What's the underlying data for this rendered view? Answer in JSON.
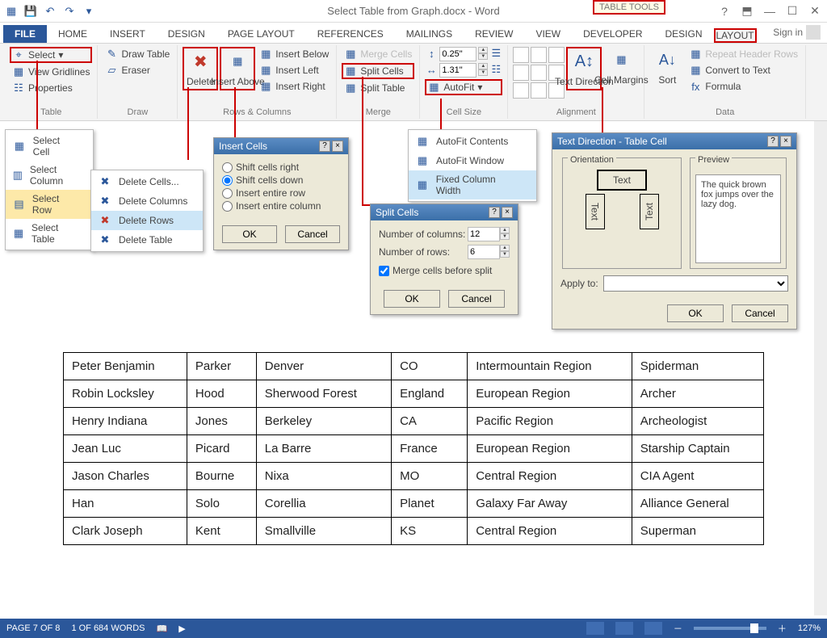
{
  "title": "Select Table from Graph.docx - Word",
  "tableTools": "TABLE TOOLS",
  "signin": "Sign in",
  "tabs": [
    "FILE",
    "HOME",
    "INSERT",
    "DESIGN",
    "PAGE LAYOUT",
    "REFERENCES",
    "MAILINGS",
    "REVIEW",
    "VIEW",
    "DEVELOPER",
    "DESIGN",
    "LAYOUT"
  ],
  "ribbon": {
    "select": "Select",
    "viewGrid": "View Gridlines",
    "properties": "Properties",
    "tableGroup": "Table",
    "drawTable": "Draw Table",
    "eraser": "Eraser",
    "drawGroup": "Draw",
    "delete": "Delete",
    "insertAbove": "Insert Above",
    "insertBelow": "Insert Below",
    "insertLeft": "Insert Left",
    "insertRight": "Insert Right",
    "rowsCols": "Rows & Columns",
    "mergeCells": "Merge Cells",
    "splitCells": "Split Cells",
    "splitTable": "Split Table",
    "mergeGroup": "Merge",
    "height": "0.25\"",
    "width": "1.31\"",
    "autofit": "AutoFit",
    "cellSize": "Cell Size",
    "alignment": "Alignment",
    "textDir": "Text Direction",
    "cellMargins": "Cell Margins",
    "sort": "Sort",
    "repeatHeader": "Repeat Header Rows",
    "convertText": "Convert to Text",
    "formula": "Formula",
    "dataGroup": "Data"
  },
  "selectMenu": [
    "Select Cell",
    "Select Column",
    "Select Row",
    "Select Table"
  ],
  "deleteMenu": [
    "Delete Cells...",
    "Delete Columns",
    "Delete Rows",
    "Delete Table"
  ],
  "autofitMenu": [
    "AutoFit Contents",
    "AutoFit Window",
    "Fixed Column Width"
  ],
  "insertCells": {
    "title": "Insert Cells",
    "opts": [
      "Shift cells right",
      "Shift cells down",
      "Insert entire row",
      "Insert entire column"
    ],
    "ok": "OK",
    "cancel": "Cancel"
  },
  "splitCells": {
    "title": "Split Cells",
    "colsLabel": "Number of columns:",
    "cols": "12",
    "rowsLabel": "Number of rows:",
    "rows": "6",
    "merge": "Merge cells before split",
    "ok": "OK",
    "cancel": "Cancel"
  },
  "textDirDlg": {
    "title": "Text Direction - Table Cell",
    "orientation": "Orientation",
    "preview": "Preview",
    "text": "Text",
    "sample": "The quick brown fox jumps over the lazy dog.",
    "apply": "Apply to:",
    "ok": "OK",
    "cancel": "Cancel"
  },
  "tableData": [
    [
      "Peter Benjamin",
      "Parker",
      "Denver",
      "CO",
      "Intermountain Region",
      "Spiderman"
    ],
    [
      "Robin Locksley",
      "Hood",
      "Sherwood Forest",
      "England",
      "European Region",
      "Archer"
    ],
    [
      "Henry Indiana",
      "Jones",
      "Berkeley",
      "CA",
      "Pacific Region",
      "Archeologist"
    ],
    [
      "Jean Luc",
      "Picard",
      "La Barre",
      "France",
      "European Region",
      "Starship Captain"
    ],
    [
      "Jason Charles",
      "Bourne",
      "Nixa",
      "MO",
      "Central Region",
      "CIA Agent"
    ],
    [
      "Han",
      "Solo",
      "Corellia",
      "Planet",
      "Galaxy Far Away",
      "Alliance General"
    ],
    [
      "Clark Joseph",
      "Kent",
      "Smallville",
      "KS",
      "Central Region",
      "Superman"
    ]
  ],
  "status": {
    "page": "PAGE 7 OF 8",
    "words": "1 OF 684 WORDS",
    "zoom": "127%"
  }
}
